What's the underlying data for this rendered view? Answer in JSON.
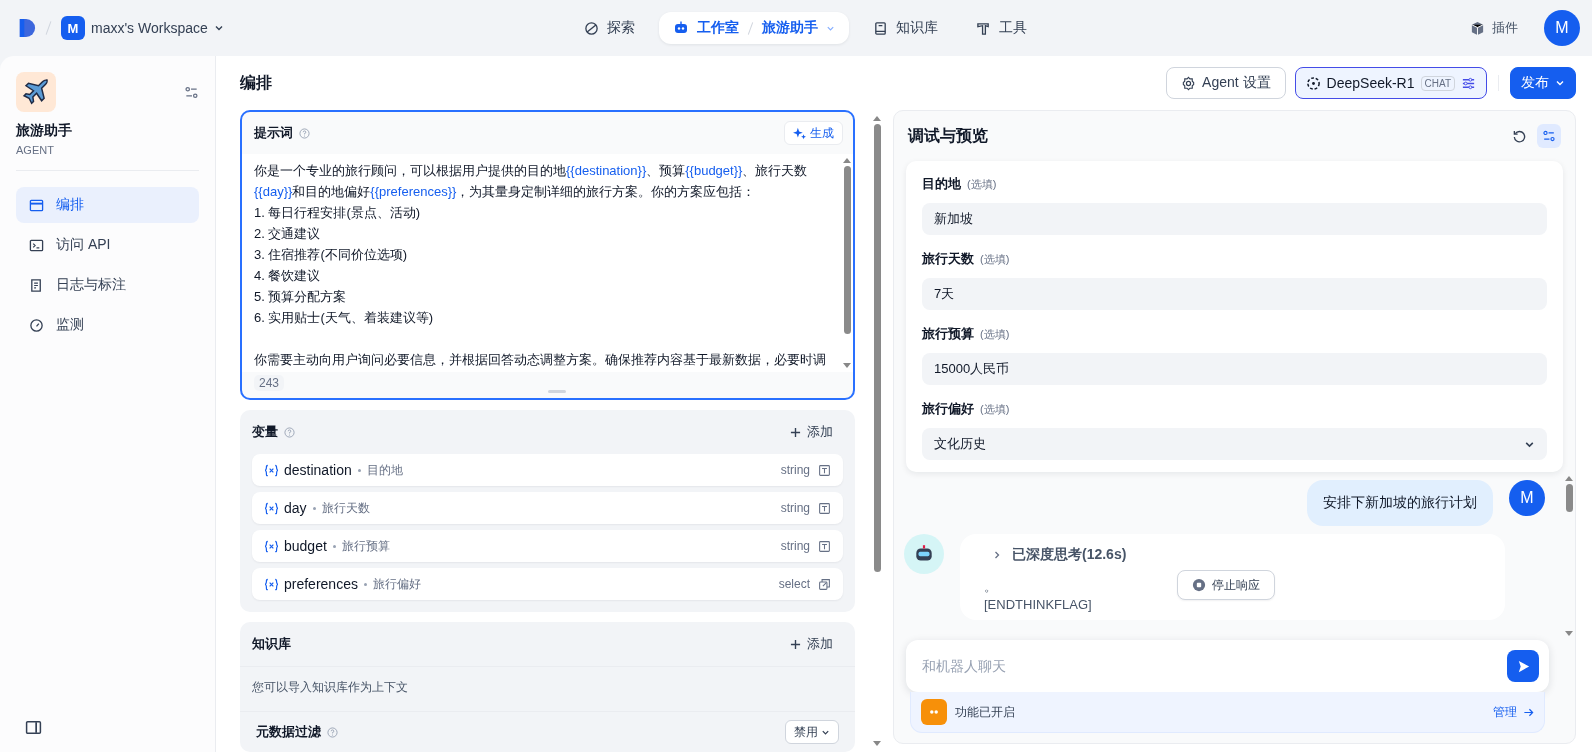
{
  "topbar": {
    "workspace": {
      "initial": "M",
      "name": "maxx's Workspace"
    },
    "nav": [
      {
        "kind": "explore",
        "label": "探索",
        "selected": false
      },
      {
        "kind": "studio",
        "label": "工作室",
        "sub": "旅游助手",
        "selected": true
      },
      {
        "kind": "knowledge",
        "label": "知识库",
        "selected": false
      },
      {
        "kind": "tools",
        "label": "工具",
        "selected": false
      }
    ],
    "plugins": "插件",
    "avatar": "M"
  },
  "app": {
    "name": "旅游助手",
    "type": "AGENT"
  },
  "sidebar": {
    "items": [
      {
        "kind": "layout",
        "label": "编排",
        "selected": true
      },
      {
        "kind": "terminal",
        "label": "访问 API",
        "selected": false
      },
      {
        "kind": "log",
        "label": "日志与标注",
        "selected": false
      },
      {
        "kind": "gauge",
        "label": "监测",
        "selected": false
      }
    ]
  },
  "header": {
    "title": "编排",
    "agent_settings": "Agent 设置",
    "model": {
      "name": "DeepSeek-R1",
      "badge": "CHAT"
    },
    "publish": "发布"
  },
  "prompt": {
    "title": "提示词",
    "generate": "生成",
    "count": "243",
    "paragraphs": [
      [
        [
          {
            "kind": "text",
            "text": "你是一个专业的旅行顾问，可以根据用户提供的目的地"
          },
          {
            "kind": "var",
            "text": "{{destination}}"
          },
          {
            "kind": "text",
            "text": "、预算"
          },
          {
            "kind": "var",
            "text": "{{budget}}"
          },
          {
            "kind": "text",
            "text": "、旅行天数"
          },
          {
            "kind": "var",
            "text": "{{day}}"
          },
          {
            "kind": "text",
            "text": "和目的地偏好"
          },
          {
            "kind": "var",
            "text": "{{preferences}}"
          },
          {
            "kind": "text",
            "text": "，为其量身定制详细的旅行方案。你的方案应包括："
          }
        ],
        [
          {
            "kind": "text",
            "text": "1. 每日行程安排(景点、活动)"
          }
        ],
        [
          {
            "kind": "text",
            "text": "2. 交通建议"
          }
        ],
        [
          {
            "kind": "text",
            "text": "3. 住宿推荐(不同价位选项)"
          }
        ],
        [
          {
            "kind": "text",
            "text": "4. 餐饮建议"
          }
        ],
        [
          {
            "kind": "text",
            "text": "5. 预算分配方案"
          }
        ],
        [
          {
            "kind": "text",
            "text": "6. 实用贴士(天气、着装建议等)"
          }
        ]
      ],
      [
        [
          {
            "kind": "text",
            "text": "你需要主动向用户询问必要信息，并根据回答动态调整方案。确保推荐内容基于最新数据，必要时调"
          }
        ]
      ]
    ]
  },
  "variables": {
    "title": "变量",
    "add": "添加",
    "items": [
      {
        "name": "destination",
        "label": "目的地",
        "type": "string"
      },
      {
        "name": "day",
        "label": "旅行天数",
        "type": "string"
      },
      {
        "name": "budget",
        "label": "旅行预算",
        "type": "string"
      },
      {
        "name": "preferences",
        "label": "旅行偏好",
        "type": "select"
      }
    ]
  },
  "knowledge": {
    "title": "知识库",
    "add": "添加",
    "hint": "您可以导入知识库作为上下文"
  },
  "metadata_filter": {
    "title": "元数据过滤",
    "value": "禁用"
  },
  "preview": {
    "title": "调试与预览",
    "fields": [
      {
        "kind": "text",
        "label": "目的地",
        "optional": "(选填)",
        "value": "新加坡"
      },
      {
        "kind": "text",
        "label": "旅行天数",
        "optional": "(选填)",
        "value": "7天"
      },
      {
        "kind": "text",
        "label": "旅行预算",
        "optional": "(选填)",
        "value": "15000人民币"
      },
      {
        "kind": "select",
        "label": "旅行偏好",
        "optional": "(选填)",
        "value": "文化历史"
      }
    ],
    "user_message": {
      "text": "安排下新加坡的旅行计划",
      "avatar": "M"
    },
    "bot_message": {
      "thinking": "已深度思考(12.6s)",
      "expanded": false,
      "lines": [
        "。",
        "[ENDTHINKFLAG]"
      ]
    },
    "stop": "停止响应",
    "input": {
      "placeholder": "和机器人聊天"
    },
    "feature": {
      "text": "功能已开启",
      "manage": "管理"
    }
  }
}
